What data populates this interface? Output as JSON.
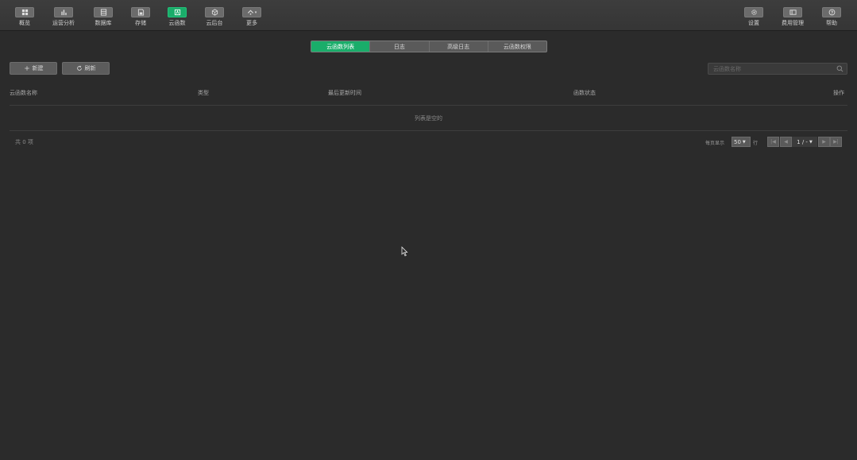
{
  "toolbar": {
    "left": [
      {
        "label": "概览",
        "icon": "overview-icon"
      },
      {
        "label": "运营分析",
        "icon": "chart-icon"
      },
      {
        "label": "数据库",
        "icon": "database-icon"
      },
      {
        "label": "存储",
        "icon": "storage-icon"
      },
      {
        "label": "云函数",
        "icon": "cloud-function-icon",
        "active": true
      },
      {
        "label": "云后台",
        "icon": "cloud-backend-icon"
      },
      {
        "label": "更多",
        "icon": "more-icon"
      }
    ],
    "right": [
      {
        "label": "设置",
        "icon": "gear-icon"
      },
      {
        "label": "费用管理",
        "icon": "billing-icon"
      },
      {
        "label": "帮助",
        "icon": "help-icon"
      }
    ]
  },
  "tabs": [
    {
      "label": "云函数列表",
      "active": true
    },
    {
      "label": "日志"
    },
    {
      "label": "高级日志"
    },
    {
      "label": "云函数权限"
    }
  ],
  "actions": {
    "new_label": "新建",
    "refresh_label": "刷新"
  },
  "search": {
    "placeholder": "云函数名称"
  },
  "table": {
    "headers": [
      "云函数名称",
      "类型",
      "最后更新时间",
      "函数状态",
      "操作"
    ],
    "empty_text": "列表是空的"
  },
  "footer": {
    "total": "共 0 项",
    "per_page_label": "每页显示",
    "per_page_value": "50",
    "per_page_unit": "行",
    "page_text": "1 / -"
  },
  "colors": {
    "accent": "#1aad6a",
    "background": "#2b2b2b",
    "toolbar": "#3a3a3a"
  }
}
